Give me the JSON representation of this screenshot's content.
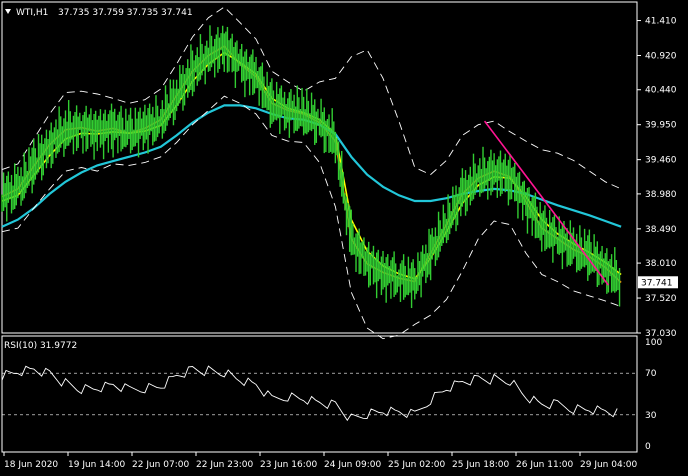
{
  "header": {
    "symbol": "WTI,H1",
    "ohlc": "37.735 37.759 37.735 37.741"
  },
  "price_panel": {
    "y_ticks": [
      "41.410",
      "40.920",
      "40.440",
      "39.950",
      "39.460",
      "38.980",
      "38.490",
      "38.010",
      "37.520",
      "37.030"
    ],
    "current_price": "37.741"
  },
  "rsi_panel": {
    "label": "RSI(10) 31.9772",
    "y_ticks": [
      "100",
      "70",
      "30",
      "0"
    ],
    "levels": [
      70,
      30
    ]
  },
  "x_axis": {
    "labels": [
      "18 Jun 2020",
      "19 Jun 14:00",
      "22 Jun 07:00",
      "22 Jun 23:00",
      "23 Jun 16:00",
      "24 Jun 09:00",
      "25 Jun 02:00",
      "25 Jun 18:00",
      "26 Jun 11:00",
      "29 Jun 04:00"
    ]
  },
  "colors": {
    "background": "#000000",
    "candles": "#32cd32",
    "ma_fast": "#ff8c00",
    "ma_mid": "#ffff00",
    "ma_slow": "#22c7d9",
    "bands": "#ffffff",
    "trendline": "#ff1493",
    "rsi": "#ffffff",
    "price_tag": "#ffffff"
  },
  "chart_data": [
    {
      "type": "line",
      "panel": "price",
      "ylim": [
        37.03,
        41.67
      ],
      "x": [
        0,
        5,
        10,
        15,
        20,
        25,
        30,
        35,
        40,
        45,
        50,
        55,
        60,
        65,
        70,
        75,
        80,
        85,
        90,
        95,
        100,
        105,
        110,
        115,
        120,
        125,
        130,
        135,
        140,
        145,
        150,
        155,
        160,
        165,
        170,
        175,
        180,
        185,
        190,
        195
      ],
      "series": [
        {
          "values": [
            38.94,
            39.05,
            39.37,
            39.67,
            39.88,
            39.91,
            39.86,
            39.9,
            39.83,
            39.9,
            40.02,
            40.36,
            40.7,
            40.92,
            41.05,
            40.8,
            40.62,
            40.25,
            40.15,
            40.1,
            39.98,
            39.72,
            38.35,
            38.0,
            37.88,
            37.8,
            37.75,
            38.15,
            38.55,
            38.98,
            39.2,
            39.3,
            39.22,
            38.87,
            38.5,
            38.35,
            38.2,
            38.1,
            37.95,
            37.74
          ]
        },
        {
          "values": [
            38.88,
            38.96,
            39.24,
            39.52,
            39.75,
            39.83,
            39.82,
            39.85,
            39.83,
            39.86,
            39.94,
            40.22,
            40.56,
            40.8,
            40.96,
            40.82,
            40.66,
            40.32,
            40.18,
            40.12,
            40.02,
            39.82,
            38.62,
            38.18,
            37.97,
            37.86,
            37.79,
            38.08,
            38.45,
            38.85,
            39.1,
            39.22,
            39.2,
            38.94,
            38.62,
            38.42,
            38.28,
            38.16,
            38.02,
            37.85
          ]
        },
        {
          "values": [
            38.52,
            38.62,
            38.78,
            38.98,
            39.15,
            39.28,
            39.38,
            39.44,
            39.5,
            39.56,
            39.64,
            39.8,
            39.98,
            40.12,
            40.22,
            40.22,
            40.18,
            40.1,
            40.04,
            40.02,
            39.95,
            39.82,
            39.5,
            39.25,
            39.08,
            38.96,
            38.88,
            38.88,
            38.92,
            38.98,
            39.02,
            39.05,
            39.03,
            38.98,
            38.9,
            38.82,
            38.75,
            38.68,
            38.6,
            38.52
          ]
        },
        {
          "values": [
            39.32,
            39.4,
            39.75,
            40.1,
            40.4,
            40.42,
            40.38,
            40.32,
            40.25,
            40.3,
            40.45,
            40.8,
            41.18,
            41.45,
            41.6,
            41.38,
            41.15,
            40.7,
            40.55,
            40.42,
            40.55,
            40.6,
            40.9,
            41.0,
            40.6,
            40.0,
            39.35,
            39.25,
            39.45,
            39.8,
            39.95,
            40.0,
            39.85,
            39.72,
            39.6,
            39.55,
            39.45,
            39.3,
            39.15,
            39.05
          ]
        },
        {
          "values": [
            38.45,
            38.5,
            38.78,
            39.05,
            39.3,
            39.35,
            39.3,
            39.4,
            39.38,
            39.42,
            39.5,
            39.7,
            39.95,
            40.15,
            40.35,
            40.25,
            40.1,
            39.8,
            39.72,
            39.7,
            39.42,
            38.8,
            37.6,
            37.1,
            36.95,
            37.0,
            37.15,
            37.28,
            37.5,
            37.9,
            38.35,
            38.6,
            38.55,
            38.15,
            37.85,
            37.75,
            37.62,
            37.55,
            37.48,
            37.4
          ]
        }
      ]
    },
    {
      "type": "line",
      "panel": "rsi",
      "ylim": [
        0,
        100
      ],
      "x": [
        0,
        5,
        10,
        15,
        20,
        25,
        30,
        35,
        40,
        45,
        50,
        55,
        60,
        65,
        70,
        75,
        80,
        85,
        90,
        95,
        100,
        105,
        110,
        115,
        120,
        125,
        130,
        135,
        140,
        145,
        150,
        155,
        160,
        165,
        170,
        175,
        180,
        185,
        190,
        195
      ],
      "series": [
        {
          "values": [
            68,
            72,
            74,
            70,
            60,
            54,
            55,
            58,
            54,
            56,
            58,
            68,
            74,
            72,
            70,
            63,
            58,
            45,
            48,
            46,
            42,
            40,
            26,
            30,
            33,
            32,
            30,
            45,
            56,
            62,
            65,
            64,
            62,
            47,
            39,
            40,
            36,
            36,
            34,
            32
          ]
        }
      ]
    }
  ]
}
